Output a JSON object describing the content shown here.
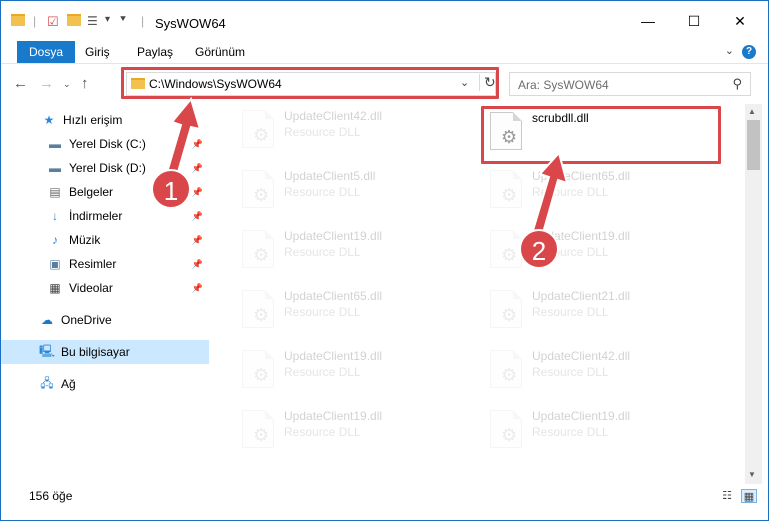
{
  "window": {
    "title": "SysWOW64",
    "minimize_glyph": "—",
    "maximize_glyph": "☐",
    "close_glyph": "✕"
  },
  "ribbon": {
    "tabs": [
      {
        "label": "Dosya",
        "active": true
      },
      {
        "label": "Giriş"
      },
      {
        "label": "Paylaş"
      },
      {
        "label": "Görünüm"
      }
    ],
    "help": "?"
  },
  "address": {
    "path": "C:\\Windows\\SysWOW64",
    "search_placeholder": "Ara: SysWOW64"
  },
  "sidebar": {
    "items": [
      {
        "label": "Hızlı erişim",
        "icon": "star-icon"
      },
      {
        "label": "Yerel Disk (C:)",
        "icon": "drive-icon",
        "pinned": true
      },
      {
        "label": "Yerel Disk (D:)",
        "icon": "drive-icon",
        "pinned": true
      },
      {
        "label": "Belgeler",
        "icon": "document-icon",
        "pinned": true
      },
      {
        "label": "İndirmeler",
        "icon": "download-icon",
        "pinned": true
      },
      {
        "label": "Müzik",
        "icon": "music-icon",
        "pinned": true
      },
      {
        "label": "Resimler",
        "icon": "pictures-icon",
        "pinned": true
      },
      {
        "label": "Videolar",
        "icon": "video-icon",
        "pinned": true
      },
      {
        "label": "OneDrive",
        "icon": "cloud-icon"
      },
      {
        "label": "Bu bilgisayar",
        "icon": "computer-icon",
        "selected": true
      },
      {
        "label": "Ağ",
        "icon": "network-icon"
      }
    ]
  },
  "files": {
    "left": [
      {
        "name": "UpdateClient42.dll",
        "type": "Resource DLL"
      },
      {
        "name": "UpdateClient5.dll",
        "type": "Resource DLL"
      },
      {
        "name": "UpdateClient19.dll",
        "type": "Resource DLL"
      },
      {
        "name": "UpdateClient65.dll",
        "type": "Resource DLL"
      },
      {
        "name": "UpdateClient19.dll",
        "type": "Resource DLL"
      },
      {
        "name": "UpdateClient19.dll",
        "type": "Resource DLL"
      }
    ],
    "right": [
      {
        "name": "scrubdll.dll",
        "type": "",
        "highlighted": true
      },
      {
        "name": "UpdateClient65.dll",
        "type": "Resource DLL"
      },
      {
        "name": "UpdateClient19.dll",
        "type": "Resource DLL"
      },
      {
        "name": "UpdateClient21.dll",
        "type": "Resource DLL"
      },
      {
        "name": "UpdateClient42.dll",
        "type": "Resource DLL"
      },
      {
        "name": "UpdateClient19.dll",
        "type": "Resource DLL"
      }
    ]
  },
  "status": {
    "count": "156 öğe"
  },
  "annotations": {
    "step1": "1",
    "step2": "2",
    "color": "#d9474a"
  }
}
